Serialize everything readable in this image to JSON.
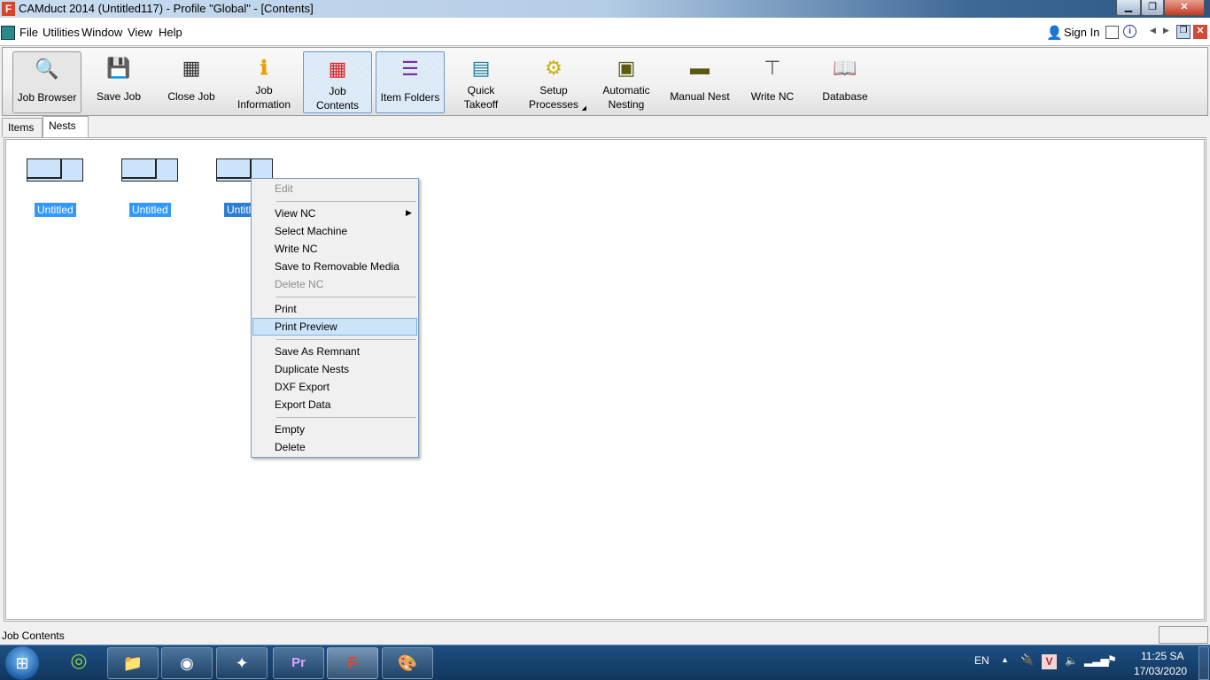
{
  "window": {
    "title": "CAMduct 2014 (Untitled117) - Profile \"Global\" - [Contents]",
    "app_icon": "F"
  },
  "menubar": {
    "items": [
      "File",
      "Utilities",
      "Window",
      "View",
      "Help"
    ],
    "sign_in": "Sign In"
  },
  "toolbar": {
    "buttons": [
      {
        "label1": "Job Browser",
        "label2": "",
        "icon": "job-browser-icon",
        "glyph": "🔍"
      },
      {
        "label1": "Save Job",
        "label2": "",
        "icon": "floppy-disk-icon",
        "glyph": "💾"
      },
      {
        "label1": "Close Job",
        "label2": "",
        "icon": "close-job-icon",
        "glyph": "▦"
      },
      {
        "label1": "Job",
        "label2": "Information",
        "icon": "info-icon",
        "glyph": "ℹ"
      },
      {
        "label1": "Job",
        "label2": "Contents",
        "icon": "grid-icon",
        "glyph": "▦"
      },
      {
        "label1": "Item Folders",
        "label2": "",
        "icon": "folders-icon",
        "glyph": "☰"
      },
      {
        "label1": "Quick",
        "label2": "Takeoff",
        "icon": "takeoff-icon",
        "glyph": "▤"
      },
      {
        "label1": "Setup",
        "label2": "Processes",
        "icon": "gear-icon",
        "glyph": "⚙"
      },
      {
        "label1": "Automatic",
        "label2": "Nesting",
        "icon": "auto-nest-icon",
        "glyph": "▣"
      },
      {
        "label1": "Manual Nest",
        "label2": "",
        "icon": "manual-nest-icon",
        "glyph": "▬"
      },
      {
        "label1": "Write NC",
        "label2": "",
        "icon": "drill-icon",
        "glyph": "⊤"
      },
      {
        "label1": "Database",
        "label2": "",
        "icon": "database-book-icon",
        "glyph": "📖"
      }
    ]
  },
  "tabs": [
    "Items",
    "Nests"
  ],
  "nests": [
    "Untitled",
    "Untitled",
    "Untitled"
  ],
  "context_menu": {
    "items": [
      "Edit",
      "View NC",
      "Select Machine",
      "Write NC",
      "Save to Removable Media",
      "Delete NC",
      "Print",
      "Print Preview",
      "Save As Remnant",
      "Duplicate Nests",
      "DXF Export",
      "Export Data",
      "Empty",
      "Delete"
    ]
  },
  "status": {
    "text": "Job Contents"
  },
  "taskbar": {
    "lang": "EN",
    "time": "11:25 SA",
    "date": "17/03/2020"
  }
}
